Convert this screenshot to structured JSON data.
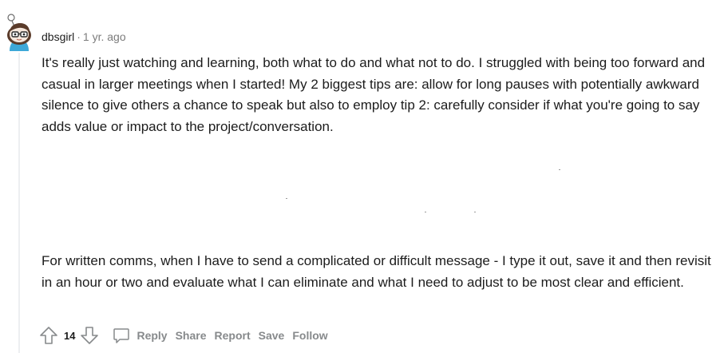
{
  "comment": {
    "username": "dbsgirl",
    "separator": "·",
    "age": "1 yr. ago",
    "paragraphs": [
      "It's really just watching and learning, both what to do and what not to do. I struggled with being too forward and casual in larger meetings when I started! My 2 biggest tips are: allow for long pauses with potentially awkward silence to give others a chance to speak but also to employ tip 2: carefully consider if what you're going to say adds value or impact to the project/conversation.",
      "For written comms, when I have to send a complicated or difficult message - I type it out, save it and then revisit in an hour or two and evaluate what I can eliminate and what I need to adjust to be most clear and efficient."
    ],
    "score": "14"
  },
  "actions": {
    "reply": "Reply",
    "share": "Share",
    "report": "Report",
    "save": "Save",
    "follow": "Follow"
  },
  "icons": {
    "avatar": "snoo-avatar",
    "upvote": "arrow-up-icon",
    "downvote": "arrow-down-icon",
    "reply": "speech-bubble-icon"
  },
  "colors": {
    "text": "#1c1c1c",
    "muted": "#7c7c7c",
    "action": "#878a8c",
    "thread_line": "#edeff1",
    "avatar_body": "#3da8d8"
  }
}
